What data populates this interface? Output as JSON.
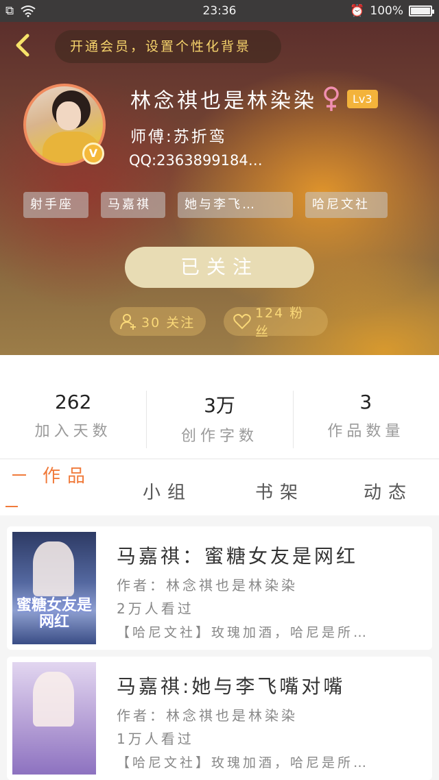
{
  "status_bar": {
    "time": "23:36",
    "battery": "100%"
  },
  "header": {
    "vip_text": "开通会员，设置个性化背景",
    "username": "林念祺也是林染染",
    "level": "Lv3",
    "master": "师傅:苏折鸾",
    "qq": "QQ:2363899184…",
    "tags": [
      "射手座",
      "马嘉祺",
      "她与李飞…",
      "哈尼文社"
    ],
    "follow_button": "已关注",
    "follows": "30 关注",
    "fans": "124 粉丝",
    "accent_color": "#f7d46c"
  },
  "stats": [
    {
      "value": "262",
      "label": "加入天数"
    },
    {
      "value": "3万",
      "label": "创作字数"
    },
    {
      "value": "3",
      "label": "作品数量"
    }
  ],
  "tabs": [
    "作品",
    "小组",
    "书架",
    "动态"
  ],
  "works": [
    {
      "title": "马嘉祺：蜜糖女友是网红",
      "author": "作者：林念祺也是林染染",
      "views": "2万人看过",
      "desc": "【哈尼文社】玫瑰加酒，哈尼是所…",
      "cover_text": "蜜糖女友是网红"
    },
    {
      "title": "马嘉祺:她与李飞嘴对嘴",
      "author": "作者：林念祺也是林染染",
      "views": "1万人看过",
      "desc": "【哈尼文社】玫瑰加酒，哈尼是所…",
      "cover_text": ""
    }
  ]
}
